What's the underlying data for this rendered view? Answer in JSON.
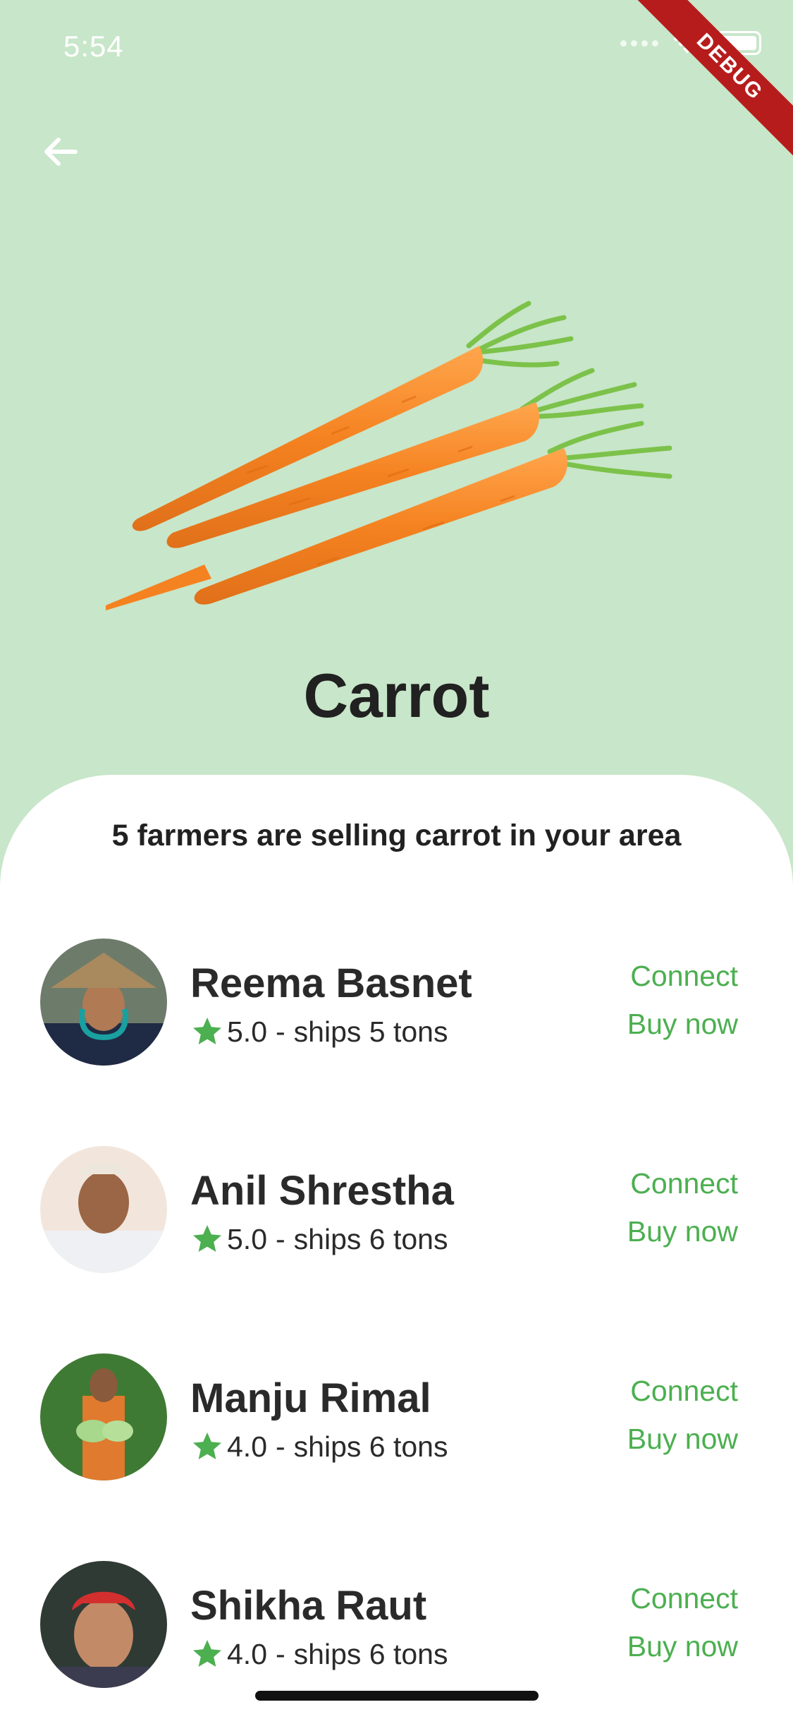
{
  "status_bar": {
    "time": "5:54"
  },
  "debug_banner": {
    "label": "DEBUG"
  },
  "product": {
    "name": "Carrot"
  },
  "sheet": {
    "subtitle": "5 farmers are selling carrot in your area",
    "farmers": [
      {
        "name": "Reema Basnet",
        "rating": "5.0",
        "separator": "-",
        "ships": "ships 5 tons",
        "connect_label": "Connect",
        "buy_label": "Buy now"
      },
      {
        "name": "Anil Shrestha",
        "rating": "5.0",
        "separator": "-",
        "ships": "ships 6 tons",
        "connect_label": "Connect",
        "buy_label": "Buy now"
      },
      {
        "name": "Manju Rimal",
        "rating": "4.0",
        "separator": "-",
        "ships": "ships 6 tons",
        "connect_label": "Connect",
        "buy_label": "Buy now"
      },
      {
        "name": "Shikha Raut",
        "rating": "4.0",
        "separator": "-",
        "ships": "ships 6 tons",
        "connect_label": "Connect",
        "buy_label": "Buy now"
      }
    ]
  },
  "colors": {
    "background": "#c8e6c9",
    "accent": "#4caf50",
    "text": "#212121",
    "debug": "#b71c1c"
  },
  "icons": {
    "back": "arrow-left-icon",
    "star": "star-icon",
    "wifi": "wifi-icon",
    "battery": "battery-icon"
  }
}
